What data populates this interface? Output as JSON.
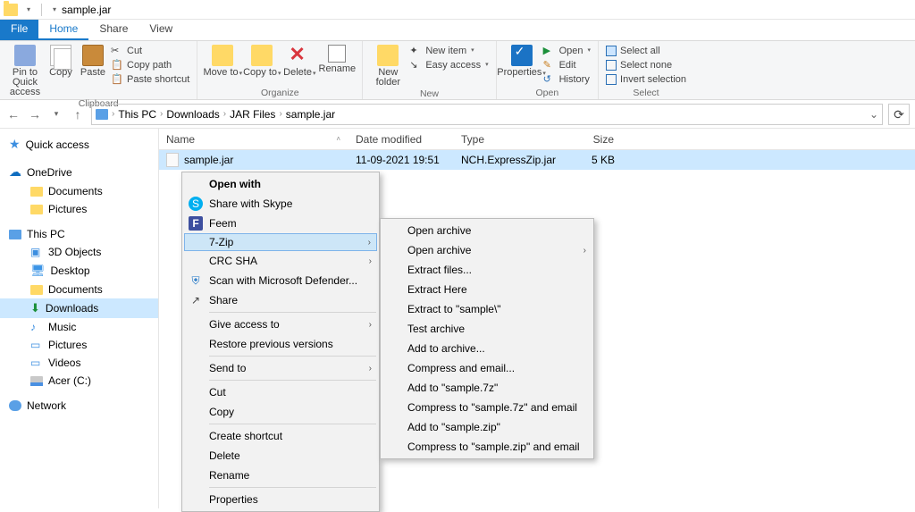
{
  "window": {
    "title": "sample.jar"
  },
  "tabs": {
    "file": "File",
    "home": "Home",
    "share": "Share",
    "view": "View"
  },
  "ribbon": {
    "clipboard": {
      "label": "Clipboard",
      "pin": "Pin to Quick access",
      "copy": "Copy",
      "paste": "Paste",
      "cut": "Cut",
      "copy_path": "Copy path",
      "paste_shortcut": "Paste shortcut"
    },
    "organize": {
      "label": "Organize",
      "move_to": "Move to",
      "copy_to": "Copy to",
      "delete": "Delete",
      "rename": "Rename"
    },
    "new": {
      "label": "New",
      "new_folder": "New folder",
      "new_item": "New item",
      "easy_access": "Easy access"
    },
    "open": {
      "label": "Open",
      "properties": "Properties",
      "open": "Open",
      "edit": "Edit",
      "history": "History"
    },
    "select": {
      "label": "Select",
      "select_all": "Select all",
      "select_none": "Select none",
      "invert": "Invert selection"
    }
  },
  "nav": {
    "pc": "This PC",
    "downloads": "Downloads",
    "jarfiles": "JAR Files",
    "filename": "sample.jar"
  },
  "sidebar": {
    "quick": "Quick access",
    "onedrive": "OneDrive",
    "documents": "Documents",
    "pictures": "Pictures",
    "thispc": "This PC",
    "objects3d": "3D Objects",
    "desktop": "Desktop",
    "documents2": "Documents",
    "downloads": "Downloads",
    "music": "Music",
    "pictures2": "Pictures",
    "videos": "Videos",
    "acer": "Acer (C:)",
    "network": "Network"
  },
  "columns": {
    "name": "Name",
    "date": "Date modified",
    "type": "Type",
    "size": "Size"
  },
  "file": {
    "name": "sample.jar",
    "date": "11-09-2021 19:51",
    "type": "NCH.ExpressZip.jar",
    "size": "5 KB"
  },
  "context": {
    "open_with": "Open with",
    "skype": "Share with Skype",
    "feem": "Feem",
    "sevenzip": "7-Zip",
    "crc": "CRC SHA",
    "defender": "Scan with Microsoft Defender...",
    "share": "Share",
    "give_access": "Give access to",
    "restore": "Restore previous versions",
    "send_to": "Send to",
    "cut": "Cut",
    "copy": "Copy",
    "create_shortcut": "Create shortcut",
    "delete": "Delete",
    "rename": "Rename",
    "properties": "Properties"
  },
  "submenu": {
    "open_archive": "Open archive",
    "open_archive2": "Open archive",
    "extract_files": "Extract files...",
    "extract_here": "Extract Here",
    "extract_sample": "Extract to \"sample\\\"",
    "test": "Test archive",
    "add": "Add to archive...",
    "compress_email": "Compress and email...",
    "add_7z": "Add to \"sample.7z\"",
    "compress_7z_email": "Compress to \"sample.7z\" and email",
    "add_zip": "Add to \"sample.zip\"",
    "compress_zip_email": "Compress to \"sample.zip\" and email"
  }
}
